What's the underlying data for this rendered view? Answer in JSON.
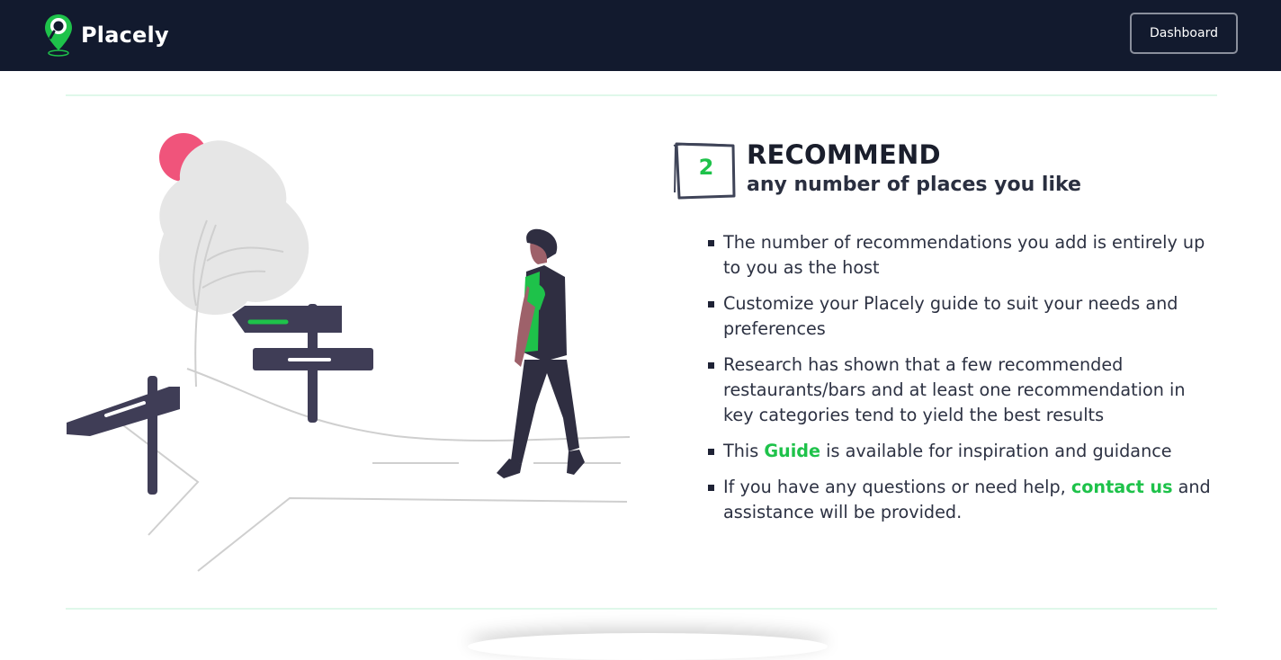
{
  "header": {
    "brand_name": "Placely",
    "dashboard_label": "Dashboard",
    "logo_icon": "map-pin-search-icon"
  },
  "step": {
    "number": "2",
    "title": "RECOMMEND",
    "subtitle": "any number of places you like"
  },
  "bullets": {
    "b1": "The number of recommendations you add is entirely up to you as the host",
    "b2": "Customize your Placely guide to suit your needs and preferences",
    "b3": "Research has shown that a few recommended restaurants/bars and at least one recommendation in key categories tend to yield the best results",
    "b4_before": "This ",
    "b4_link": "Guide",
    "b4_after": " is available for inspiration and guidance",
    "b5_before": "If you have any questions or need help, ",
    "b5_link": "contact us",
    "b5_after": " and assistance will be provided."
  },
  "colors": {
    "navbar": "#121a2e",
    "accent_green": "#1ec24a",
    "signpost": "#3f3d56",
    "sun_pink": "#f0547b"
  }
}
